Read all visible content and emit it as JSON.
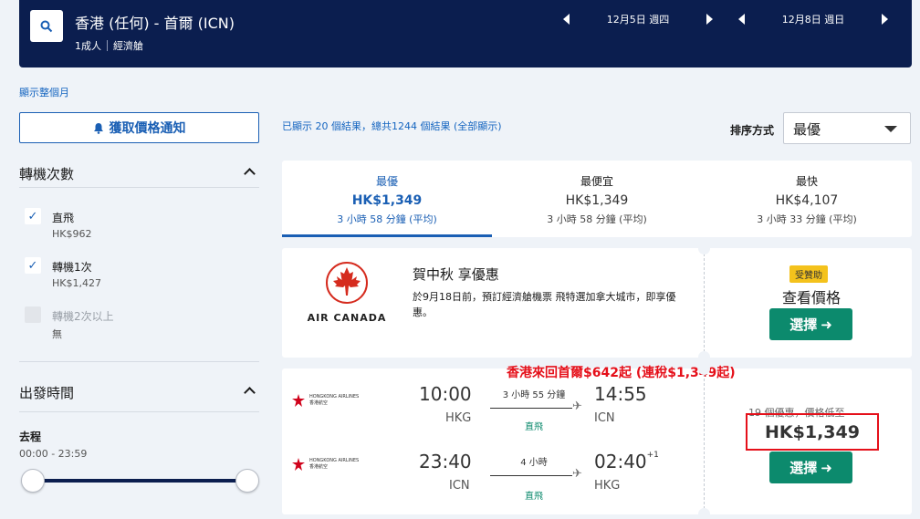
{
  "header": {
    "route": "香港 (任何) - 首爾 (ICN)",
    "passengers": "1成人",
    "cabin": "經濟艙",
    "depart_date": "12月5日 週四",
    "return_date": "12月8日 週日"
  },
  "show_month": "顯示整個月",
  "alert_button": "獲取價格通知",
  "filters": {
    "stops_title": "轉機次數",
    "stops": [
      {
        "label": "直飛",
        "price": "HK$962",
        "checked": true
      },
      {
        "label": "轉機1次",
        "price": "HK$1,427",
        "checked": true
      },
      {
        "label": "轉機2次以上",
        "price": "無",
        "checked": false
      }
    ],
    "time_title": "出發時間",
    "outbound_label": "去程",
    "outbound_range": "00:00 - 23:59"
  },
  "results": {
    "summary": "已顯示 20 個結果，總共1244 個結果 (全部顯示)",
    "sort_label": "排序方式",
    "sort_value": "最優"
  },
  "tabs": [
    {
      "name": "最優",
      "price": "HK$1,349",
      "duration": "3 小時 58 分鐘 (平均)"
    },
    {
      "name": "最便宜",
      "price": "HK$1,349",
      "duration": "3 小時 58 分鐘 (平均)"
    },
    {
      "name": "最快",
      "price": "HK$4,107",
      "duration": "3 小時 33 分鐘 (平均)"
    }
  ],
  "ad": {
    "airline": "AIR CANADA",
    "title": "賀中秋 享優惠",
    "description": "於9月18日前，預訂經濟艙機票 飛特選加拿大城市，即享優惠。",
    "badge": "受贊助",
    "view_price": "查看價格",
    "select": "選擇"
  },
  "flight": {
    "promo": "香港來回首爾$642起 (連稅$1,349起)",
    "airline_en": "HONGKONG AIRLINES",
    "airline_zh": "香港航空",
    "outbound": {
      "depart": "10:00",
      "depart_ap": "HKG",
      "arrive": "14:55",
      "arrive_ap": "ICN",
      "duration": "3 小時 55 分鐘",
      "stops": "直飛"
    },
    "inbound": {
      "depart": "23:40",
      "depart_ap": "ICN",
      "arrive": "02:40",
      "arrive_ap": "HKG",
      "plus": "+1",
      "duration": "4 小時",
      "stops": "直飛"
    },
    "offers": "19 個優惠，價格低至",
    "price": "HK$1,349",
    "select": "選擇"
  },
  "colors": {
    "header_bg": "#0b1e4f",
    "accent": "#1a5fb4",
    "green": "#0c8a6d",
    "promo_red": "#e5101a"
  }
}
